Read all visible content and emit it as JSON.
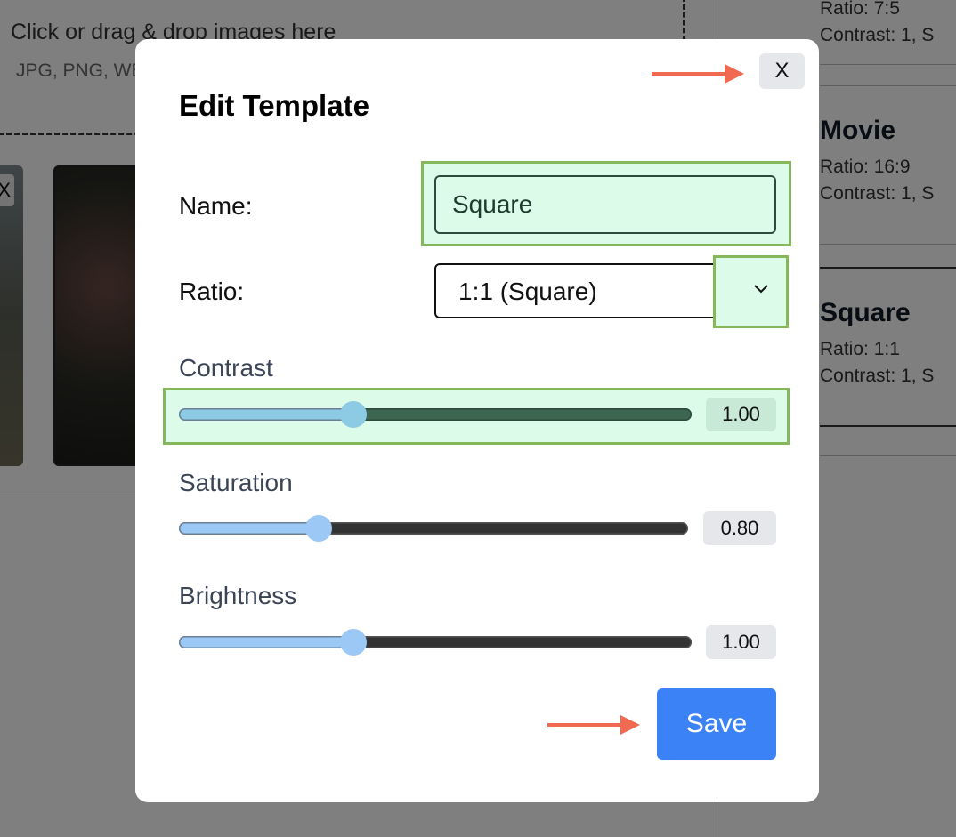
{
  "background": {
    "dropzone": {
      "title": "Click or drag & drop images here",
      "subtitle": "JPG, PNG, WEBP"
    },
    "thumb_close": "X",
    "templates": [
      {
        "line1": "Ratio: 7:5",
        "line2": "Contrast: 1, S"
      },
      {
        "name": "Movie",
        "line1": "Ratio: 16:9",
        "line2": "Contrast: 1, S"
      },
      {
        "name": "Square",
        "line1": "Ratio: 1:1",
        "line2": "Contrast: 1, S"
      }
    ]
  },
  "modal": {
    "title": "Edit Template",
    "close_label": "X",
    "name_label": "Name:",
    "name_value": "Square",
    "ratio_label": "Ratio:",
    "ratio_value": "1:1 (Square)",
    "sliders": [
      {
        "label": "Contrast",
        "value": "1.00",
        "fraction": 0.34
      },
      {
        "label": "Saturation",
        "value": "0.80",
        "fraction": 0.275
      },
      {
        "label": "Brightness",
        "value": "1.00",
        "fraction": 0.34
      }
    ],
    "save_label": "Save"
  },
  "colors": {
    "accent": "#3b82f6",
    "highlight_fill": "#dcfbe9",
    "highlight_border": "#85b85a",
    "annotation_arrow": "#ef6a50"
  }
}
